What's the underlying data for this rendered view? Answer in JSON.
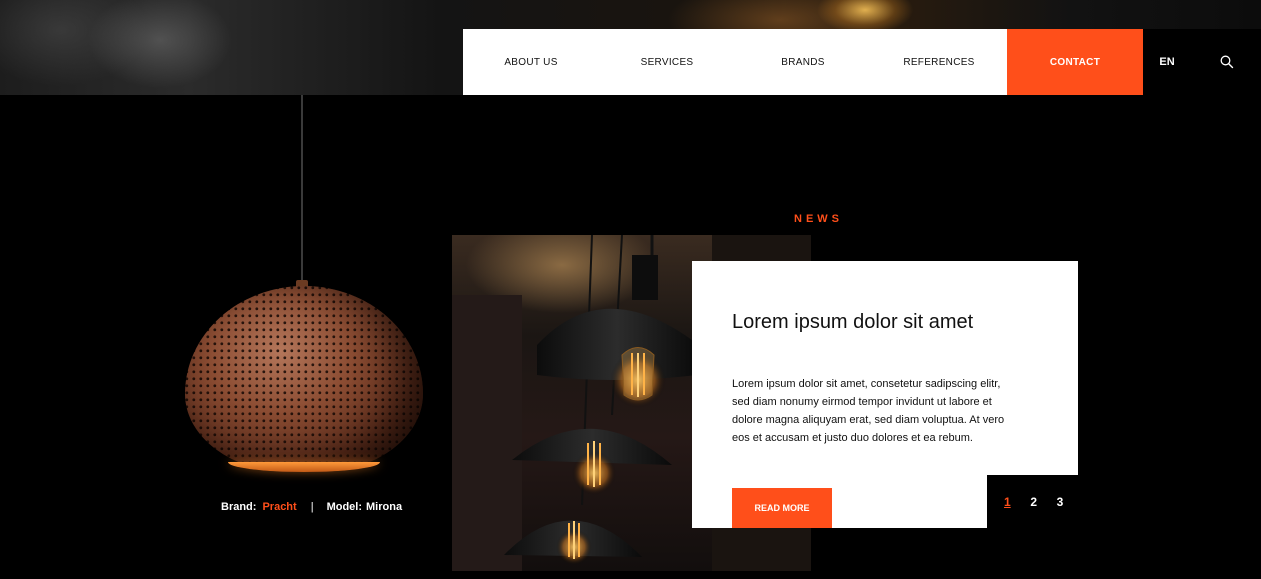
{
  "nav": {
    "items": [
      {
        "label": "ABOUT US"
      },
      {
        "label": "SERVICES"
      },
      {
        "label": "BRANDS"
      },
      {
        "label": "REFERENCES"
      },
      {
        "label": "CONTACT"
      }
    ],
    "language": "EN",
    "search_icon": "search-icon"
  },
  "product": {
    "brand_label": "Brand:",
    "brand_value": "Pracht",
    "separator": "|",
    "model_label": "Model:",
    "model_value": "Mirona"
  },
  "news": {
    "section_label": "NEWS",
    "title": "Lorem ipsum dolor sit amet",
    "body": "Lorem ipsum dolor sit amet, consetetur sadipscing elitr, sed diam nonumy eirmod tempor invidunt ut labore et dolore magna aliquyam erat, sed diam voluptua. At vero eos et accusam et justo duo dolores et ea rebum.",
    "button_label": "READ MORE",
    "pages": [
      "1",
      "2",
      "3"
    ],
    "active_page": "1"
  },
  "colors": {
    "accent": "#ff4f1a",
    "background": "#000000",
    "card": "#ffffff"
  }
}
